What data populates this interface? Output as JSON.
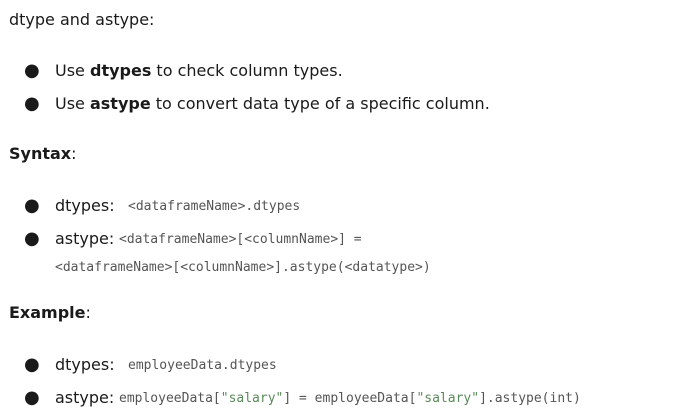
{
  "heading": "dtype and astype:",
  "bullets_intro": {
    "b1_pre": "Use ",
    "b1_bold": "dtypes",
    "b1_post": " to check column types.",
    "b2_pre": "Use ",
    "b2_bold": "astype",
    "b2_post": " to convert data type of a specific column."
  },
  "syntax": {
    "title": "Syntax",
    "colon": ":",
    "dtypes_label": "dtypes:",
    "dtypes_code": "<dataframeName>.dtypes",
    "astype_label": "astype:",
    "astype_code_line1": "<dataframeName>[<columnName>] =",
    "astype_code_line2": "<dataframeName>[<columnName>].astype(<datatype>)"
  },
  "example": {
    "title": "Example",
    "colon": ":",
    "dtypes_label": "dtypes:",
    "dtypes_code": "employeeData.dtypes",
    "astype_label": "astype:",
    "astype_code_a": "employeeData[",
    "astype_code_str1": "\"salary\"",
    "astype_code_b": "] = employeeData[",
    "astype_code_str2": "\"salary\"",
    "astype_code_c": "].astype(int)"
  },
  "bullet_glyph": "●"
}
